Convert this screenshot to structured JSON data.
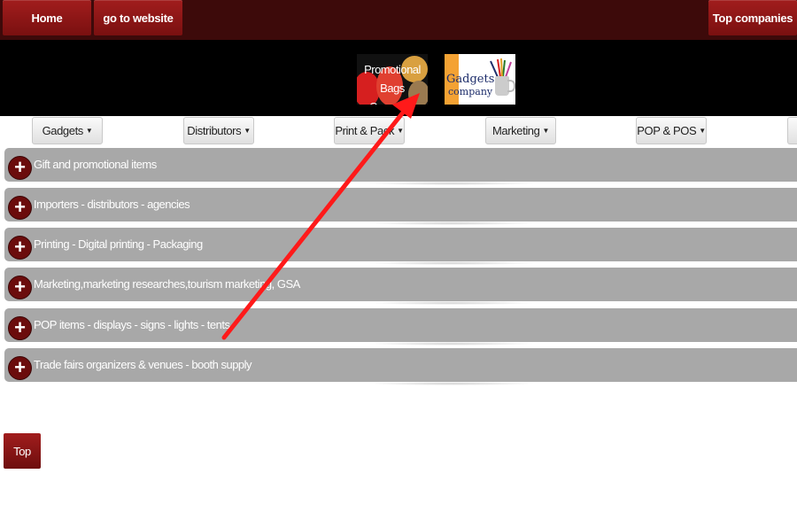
{
  "nav": {
    "home": "Home",
    "website": "go to website",
    "top_companies": "Top companies"
  },
  "logos": {
    "left": {
      "line1": "Promotional",
      "line2": "Bags Company"
    },
    "right": {
      "line1": "Gadgets",
      "line2": "company"
    }
  },
  "menu": [
    {
      "label": "Gadgets",
      "caret": "▼"
    },
    {
      "label": "Distributors",
      "caret": "▼"
    },
    {
      "label": "Print & Pack",
      "caret": "▼"
    },
    {
      "label": "Marketing",
      "caret": "▼"
    },
    {
      "label": "POP & POS",
      "caret": "▼"
    }
  ],
  "categories": [
    "Gift and promotional items",
    "Importers - distributors - agencies",
    "Printing - Digital printing - Packaging",
    "Marketing,marketing researches,tourism marketing, GSA",
    "POP items - displays - signs - lights - tents",
    "Trade fairs organizers & venues - booth supply"
  ],
  "expand_symbol": "+",
  "footer": {
    "top": "Top"
  },
  "colors": {
    "accent": "#7a1010",
    "bar": "#3d0a0a",
    "annotation_arrow": "#ff0000"
  },
  "icons": {
    "plus": "plus-icon",
    "caret": "caret-down-icon",
    "arrow": "annotation-arrow"
  }
}
